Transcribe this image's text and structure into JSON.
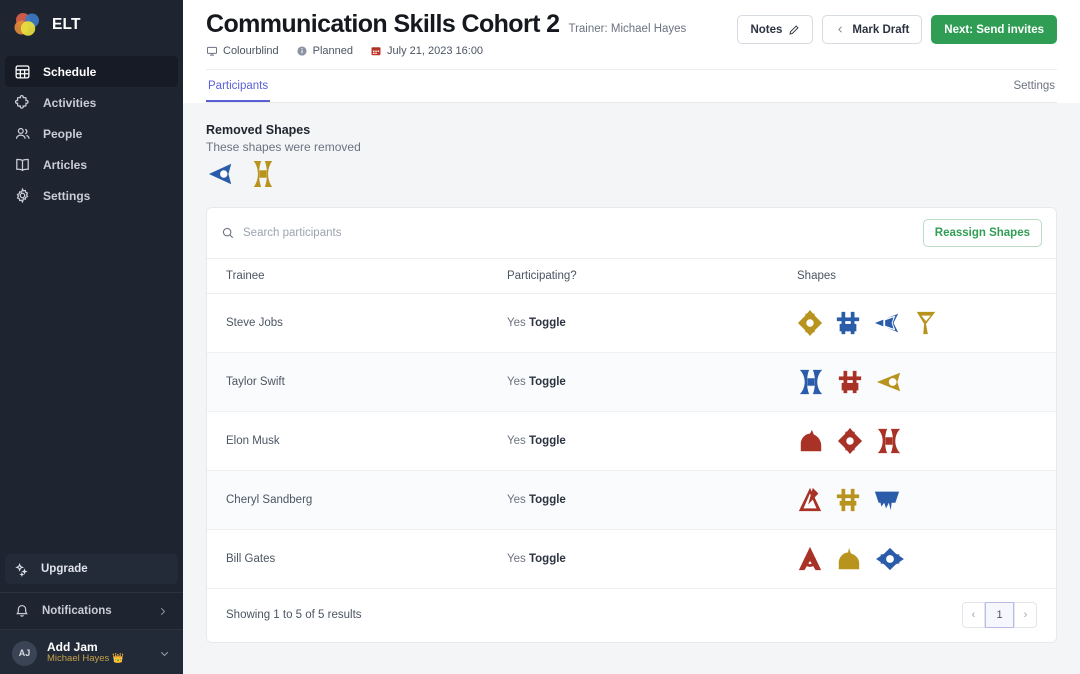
{
  "sidebar": {
    "brand": {
      "name": "ELT",
      "logo_icon": "color-circles-logo"
    },
    "items": [
      {
        "label": "Schedule",
        "icon": "calendar-grid-icon",
        "active": true
      },
      {
        "label": "Activities",
        "icon": "puzzle-piece-icon",
        "active": false
      },
      {
        "label": "People",
        "icon": "people-icon",
        "active": false
      },
      {
        "label": "Articles",
        "icon": "open-book-icon",
        "active": false
      },
      {
        "label": "Settings",
        "icon": "gear-icon",
        "active": false
      }
    ],
    "upgrade": {
      "label": "Upgrade",
      "icon": "sparkles-icon"
    },
    "notifications": {
      "label": "Notifications",
      "icon": "bell-icon",
      "chevron": "chevron-right-icon"
    },
    "user": {
      "initials": "AJ",
      "name": "Add Jam",
      "subtitle": "Michael Hayes 👑",
      "chevron": "chevron-down-icon"
    }
  },
  "header": {
    "title": "Communication Skills Cohort 2",
    "trainer": "Trainer: Michael Hayes",
    "meta": [
      {
        "label": "Colourblind",
        "icon": "presentation-icon"
      },
      {
        "label": "Planned",
        "icon": "info-circle-icon"
      },
      {
        "label": "July 21, 2023 16:00",
        "icon": "calendar-icon"
      }
    ],
    "actions": {
      "notes": {
        "label": "Notes",
        "icon": "pencil-icon"
      },
      "mark_draft": {
        "label": "Mark Draft",
        "icon": "chevron-left-icon"
      },
      "next": {
        "label": "Next: Send invites"
      }
    }
  },
  "tabs": {
    "items": [
      {
        "label": "Participants",
        "active": true
      }
    ],
    "right": {
      "label": "Settings"
    }
  },
  "removed": {
    "title": "Removed Shapes",
    "subtitle": "These shapes were removed",
    "shapes": [
      {
        "name": "arrow-left-eye-shape",
        "color": "#2a5caa",
        "glyph": "arrow-eye"
      },
      {
        "name": "bowtie-shape",
        "color": "#b8941f",
        "glyph": "bowtie"
      }
    ]
  },
  "search": {
    "placeholder": "Search participants",
    "value": "",
    "icon": "search-icon"
  },
  "reassign_button": {
    "label": "Reassign Shapes"
  },
  "table": {
    "columns": [
      "Trainee",
      "Participating?",
      "Shapes"
    ],
    "rows": [
      {
        "trainee": "Steve Jobs",
        "participating": "Yes",
        "toggle_label": "Toggle",
        "shapes": [
          {
            "glyph": "diamond-eye",
            "color": "#b8941f"
          },
          {
            "glyph": "hash-block",
            "color": "#2a5caa"
          },
          {
            "glyph": "flag-triangle-left",
            "color": "#2a5caa"
          },
          {
            "glyph": "flag-triangle-right",
            "color": "#b8941f"
          }
        ]
      },
      {
        "trainee": "Taylor Swift",
        "participating": "Yes",
        "toggle_label": "Toggle",
        "shapes": [
          {
            "glyph": "bowtie",
            "color": "#2a5caa"
          },
          {
            "glyph": "hash-block",
            "color": "#a93226"
          },
          {
            "glyph": "arrow-eye",
            "color": "#b8941f"
          }
        ]
      },
      {
        "trainee": "Elon Musk",
        "participating": "Yes",
        "toggle_label": "Toggle",
        "shapes": [
          {
            "glyph": "dome",
            "color": "#a93226"
          },
          {
            "glyph": "diamond-eye",
            "color": "#a93226"
          },
          {
            "glyph": "bowtie",
            "color": "#a93226"
          }
        ]
      },
      {
        "trainee": "Cheryl Sandberg",
        "participating": "Yes",
        "toggle_label": "Toggle",
        "shapes": [
          {
            "glyph": "triangle-slash",
            "color": "#a93226"
          },
          {
            "glyph": "hash-block",
            "color": "#b8941f"
          },
          {
            "glyph": "cup-drip",
            "color": "#2a5caa"
          }
        ]
      },
      {
        "trainee": "Bill Gates",
        "participating": "Yes",
        "toggle_label": "Toggle",
        "shapes": [
          {
            "glyph": "triangle-ring",
            "color": "#a93226"
          },
          {
            "glyph": "dome",
            "color": "#b8941f"
          },
          {
            "glyph": "diamond-eye-wide",
            "color": "#2a5caa"
          }
        ]
      }
    ]
  },
  "footer": {
    "results_text": "Showing 1 to 5 of 5 results",
    "pagination": {
      "prev": "‹",
      "pages": [
        "1"
      ],
      "next": "›"
    }
  }
}
